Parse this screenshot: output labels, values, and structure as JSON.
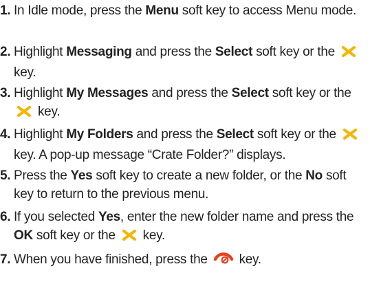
{
  "steps": [
    {
      "number": "1.",
      "parts": [
        {
          "t": "In Idle mode, press the "
        },
        {
          "t": "Menu",
          "b": true
        },
        {
          "t": " soft key to access Menu mode."
        }
      ]
    },
    {
      "number": "2.",
      "parts": [
        {
          "t": "Highlight "
        },
        {
          "t": "Messaging",
          "b": true
        },
        {
          "t": " and press the "
        },
        {
          "t": "Select",
          "b": true
        },
        {
          "t": " soft key or the "
        },
        {
          "icon": "navigation-key-icon"
        },
        {
          "t": " key."
        }
      ]
    },
    {
      "number": "3.",
      "parts": [
        {
          "t": "Highlight "
        },
        {
          "t": "My Messages",
          "b": true
        },
        {
          "t": " and press the "
        },
        {
          "t": "Select",
          "b": true
        },
        {
          "t": " soft key or the "
        },
        {
          "icon": "navigation-key-icon"
        },
        {
          "t": " key."
        }
      ]
    },
    {
      "number": "4.",
      "parts": [
        {
          "t": "Highlight "
        },
        {
          "t": "My Folders",
          "b": true
        },
        {
          "t": " and press the "
        },
        {
          "t": "Select",
          "b": true
        },
        {
          "t": " soft key or the "
        },
        {
          "icon": "navigation-key-icon"
        },
        {
          "t": " key. A pop-up message “Crate Folder?” displays."
        }
      ]
    },
    {
      "number": "5.",
      "parts": [
        {
          "t": "Press the "
        },
        {
          "t": "Yes",
          "b": true
        },
        {
          "t": " soft key to create a new folder, or the "
        },
        {
          "t": "No",
          "b": true
        },
        {
          "t": " soft key to return to the previous menu."
        }
      ]
    },
    {
      "number": "6.",
      "parts": [
        {
          "t": "If you selected "
        },
        {
          "t": "Yes",
          "b": true
        },
        {
          "t": ", enter the new folder name and press the "
        },
        {
          "t": "OK",
          "b": true
        },
        {
          "t": " soft key or the "
        },
        {
          "icon": "navigation-key-icon"
        },
        {
          "t": " key."
        }
      ]
    },
    {
      "number": "7.",
      "parts": [
        {
          "t": "When you have finished, press the "
        },
        {
          "icon": "end-call-key-icon"
        },
        {
          "t": " key."
        }
      ]
    }
  ],
  "colors": {
    "text": "#222222",
    "navigation_key_icon": "#f2b705",
    "end_call_key_icon": "#e8401c"
  }
}
